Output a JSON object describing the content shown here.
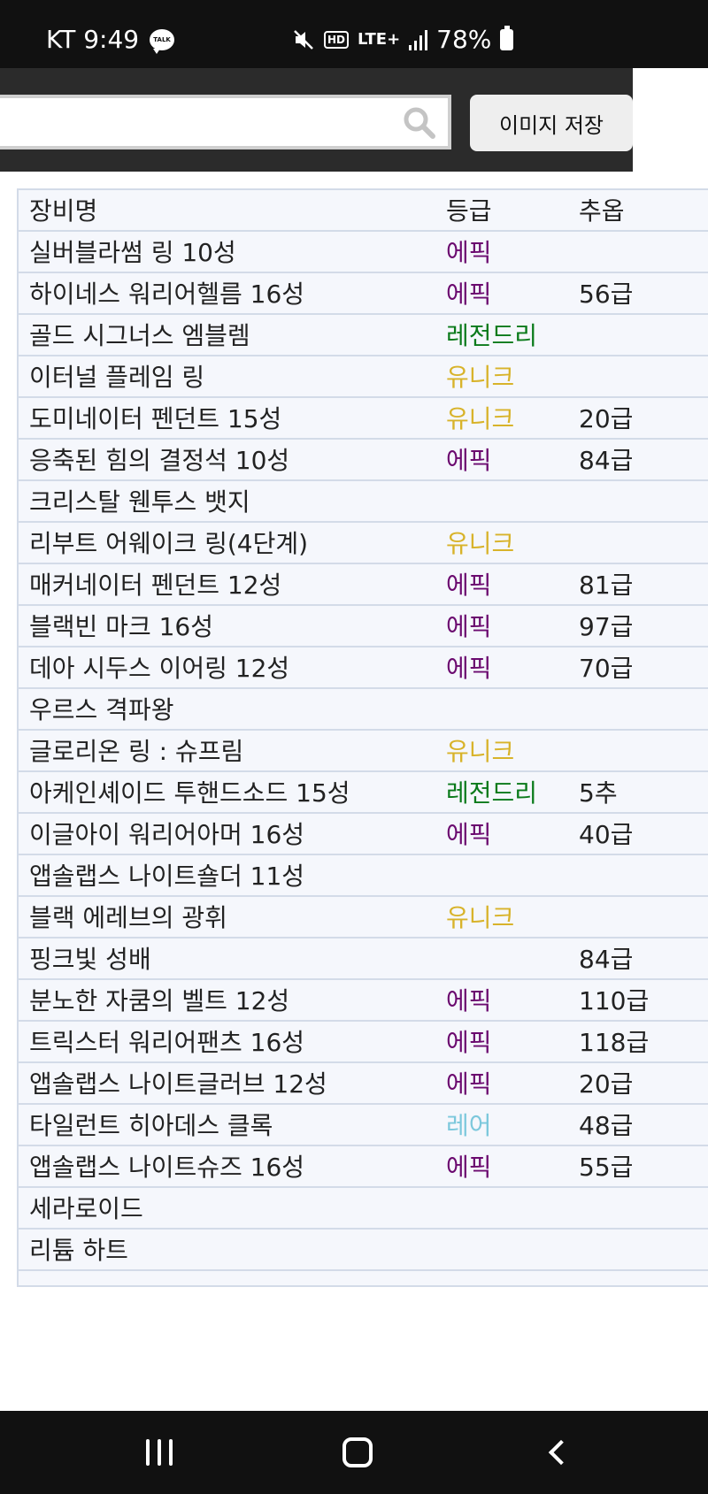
{
  "status_bar": {
    "carrier_time": "KT 9:49",
    "talk_badge": "TALK",
    "network": "LTE+",
    "hd": "HD",
    "battery": "78%"
  },
  "toolbar": {
    "search_value": "",
    "save_label": "이미지 저장"
  },
  "table": {
    "headers": {
      "name": "장비명",
      "grade": "등급",
      "option": "추옵"
    },
    "rows": [
      {
        "name": "실버블라썸 링 10성",
        "grade": "에픽",
        "option": ""
      },
      {
        "name": "하이네스 워리어헬름 16성",
        "grade": "에픽",
        "option": "56급"
      },
      {
        "name": "골드 시그너스 엠블렘",
        "grade": "레전드리",
        "option": ""
      },
      {
        "name": "이터널 플레임 링",
        "grade": "유니크",
        "option": ""
      },
      {
        "name": "도미네이터 펜던트 15성",
        "grade": "유니크",
        "option": "20급"
      },
      {
        "name": "응축된 힘의 결정석 10성",
        "grade": "에픽",
        "option": "84급"
      },
      {
        "name": "크리스탈 웬투스 뱃지",
        "grade": "",
        "option": ""
      },
      {
        "name": "리부트 어웨이크 링(4단계)",
        "grade": "유니크",
        "option": ""
      },
      {
        "name": "매커네이터 펜던트 12성",
        "grade": "에픽",
        "option": "81급"
      },
      {
        "name": "블랙빈 마크 16성",
        "grade": "에픽",
        "option": "97급"
      },
      {
        "name": "데아 시두스 이어링 12성",
        "grade": "에픽",
        "option": "70급"
      },
      {
        "name": "우르스 격파왕",
        "grade": "",
        "option": ""
      },
      {
        "name": "글로리온 링 : 슈프림",
        "grade": "유니크",
        "option": ""
      },
      {
        "name": "아케인셰이드 투핸드소드 15성",
        "grade": "레전드리",
        "option": "5추"
      },
      {
        "name": "이글아이 워리어아머 16성",
        "grade": "에픽",
        "option": "40급"
      },
      {
        "name": "앱솔랩스 나이트숄더 11성",
        "grade": "",
        "option": ""
      },
      {
        "name": "블랙 에레브의 광휘",
        "grade": "유니크",
        "option": ""
      },
      {
        "name": "핑크빛 성배",
        "grade": "",
        "option": "84급"
      },
      {
        "name": "분노한 자쿰의 벨트 12성",
        "grade": "에픽",
        "option": "110급"
      },
      {
        "name": "트릭스터 워리어팬츠 16성",
        "grade": "에픽",
        "option": "118급"
      },
      {
        "name": "앱솔랩스 나이트글러브 12성",
        "grade": "에픽",
        "option": "20급"
      },
      {
        "name": "타일런트 히아데스 클록",
        "grade": "레어",
        "option": "48급"
      },
      {
        "name": "앱솔랩스 나이트슈즈 16성",
        "grade": "에픽",
        "option": "55급"
      },
      {
        "name": "세라로이드",
        "grade": "",
        "option": ""
      },
      {
        "name": "리튬 하트",
        "grade": "",
        "option": ""
      }
    ]
  },
  "grade_colors": {
    "에픽": "#6b0a6f",
    "레전드리": "#0a7a1a",
    "유니크": "#d8b32a",
    "레어": "#7cc8dc"
  },
  "nav": {
    "recent_icon": "recent-apps-icon",
    "home_icon": "home-icon",
    "back_icon": "back-icon"
  }
}
